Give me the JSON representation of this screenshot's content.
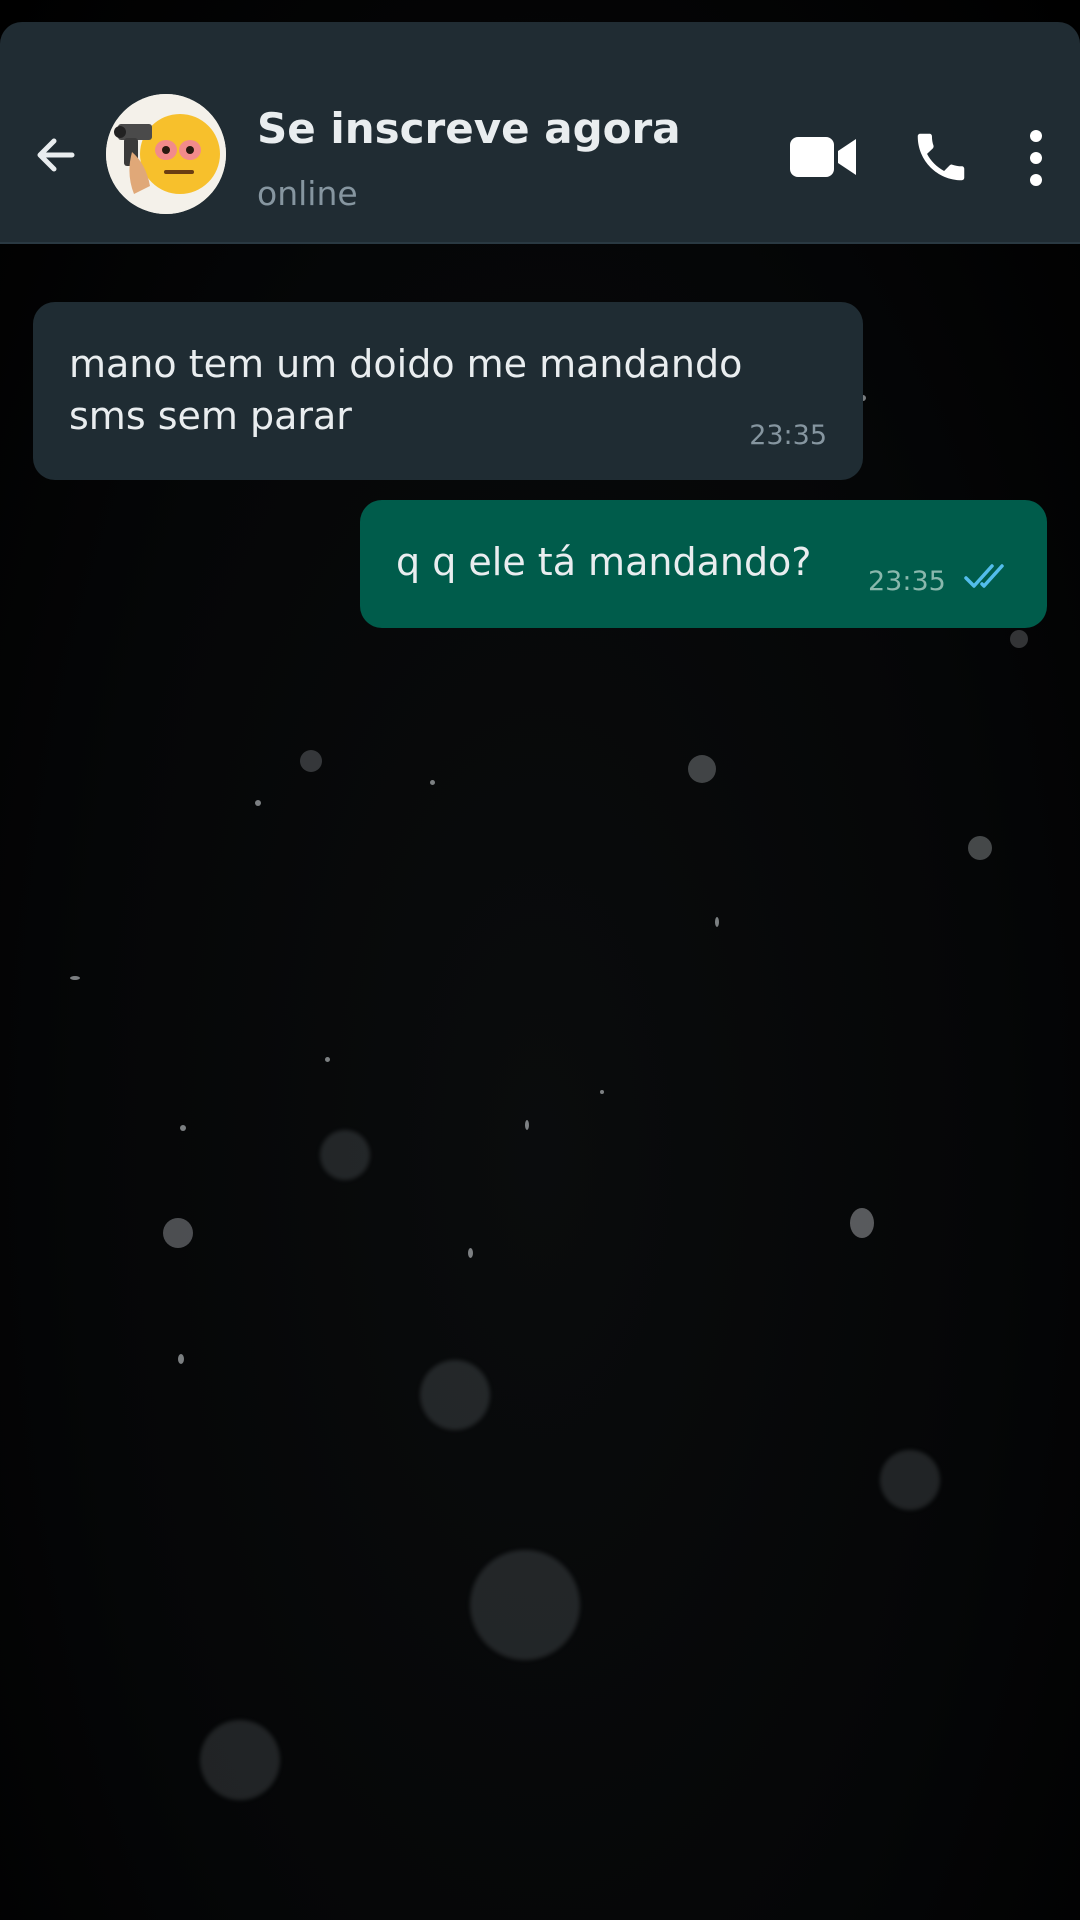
{
  "header": {
    "back_icon": "arrow-left-icon",
    "avatar_icon": "emoji-gun-avatar",
    "contact_name": "Se inscreve agora",
    "status": "online",
    "video_icon": "video-camera-icon",
    "call_icon": "phone-icon",
    "more_icon": "more-vertical-icon",
    "bg_color": "#202c33"
  },
  "messages": [
    {
      "direction": "incoming",
      "text": "mano tem um doido me mandando sms sem parar",
      "time": "23:35",
      "bubble_color": "#1f2c33"
    },
    {
      "direction": "outgoing",
      "text": "q q ele tá mandando?",
      "time": "23:35",
      "status_icon": "double-check-read-icon",
      "bubble_color": "#005c4b",
      "tick_color": "#53bdeb"
    }
  ],
  "background": {
    "style": "dark dust particles",
    "color": "#000000"
  }
}
